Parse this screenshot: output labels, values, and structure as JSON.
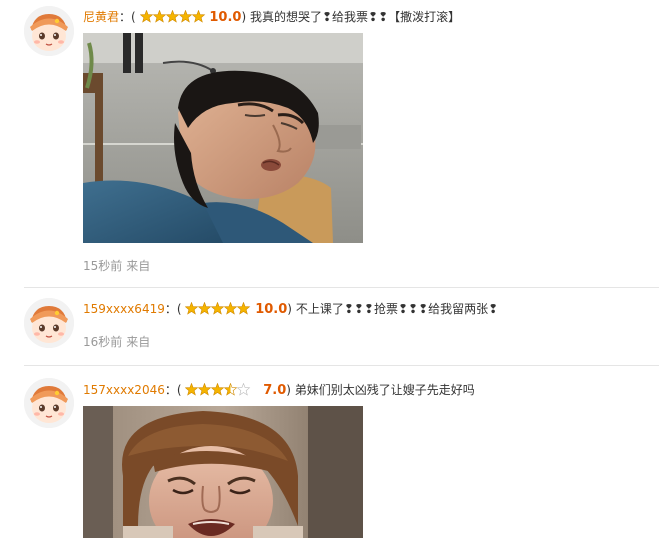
{
  "comments": [
    {
      "username": "尼黄君",
      "colon": "：",
      "open_paren": "(",
      "close_paren": ")",
      "rating_stars": 5,
      "score": "10.0",
      "text": "我真的想哭了❢给我票❢❢【撒泼打滚】",
      "time": "15秒前",
      "source": "来自",
      "has_image": true
    },
    {
      "username": "159xxxx6419",
      "colon": "：",
      "open_paren": "(",
      "close_paren": ")",
      "rating_stars": 5,
      "score": "10.0",
      "text": "不上课了❢❢❢抢票❢❢❢给我留两张❢",
      "time": "16秒前",
      "source": "来自",
      "has_image": false
    },
    {
      "username": "157xxxx2046",
      "colon": "：",
      "open_paren": "(",
      "close_paren": ")",
      "rating_stars": 3.5,
      "score": "7.0",
      "text": "弟妹们别太凶残了让嫂子先走好吗",
      "has_image": true
    }
  ],
  "colors": {
    "username": "#e07a00",
    "score": "#e05a00",
    "star": "#f5b400",
    "meta": "#999999",
    "divider": "#e5e5e5"
  }
}
